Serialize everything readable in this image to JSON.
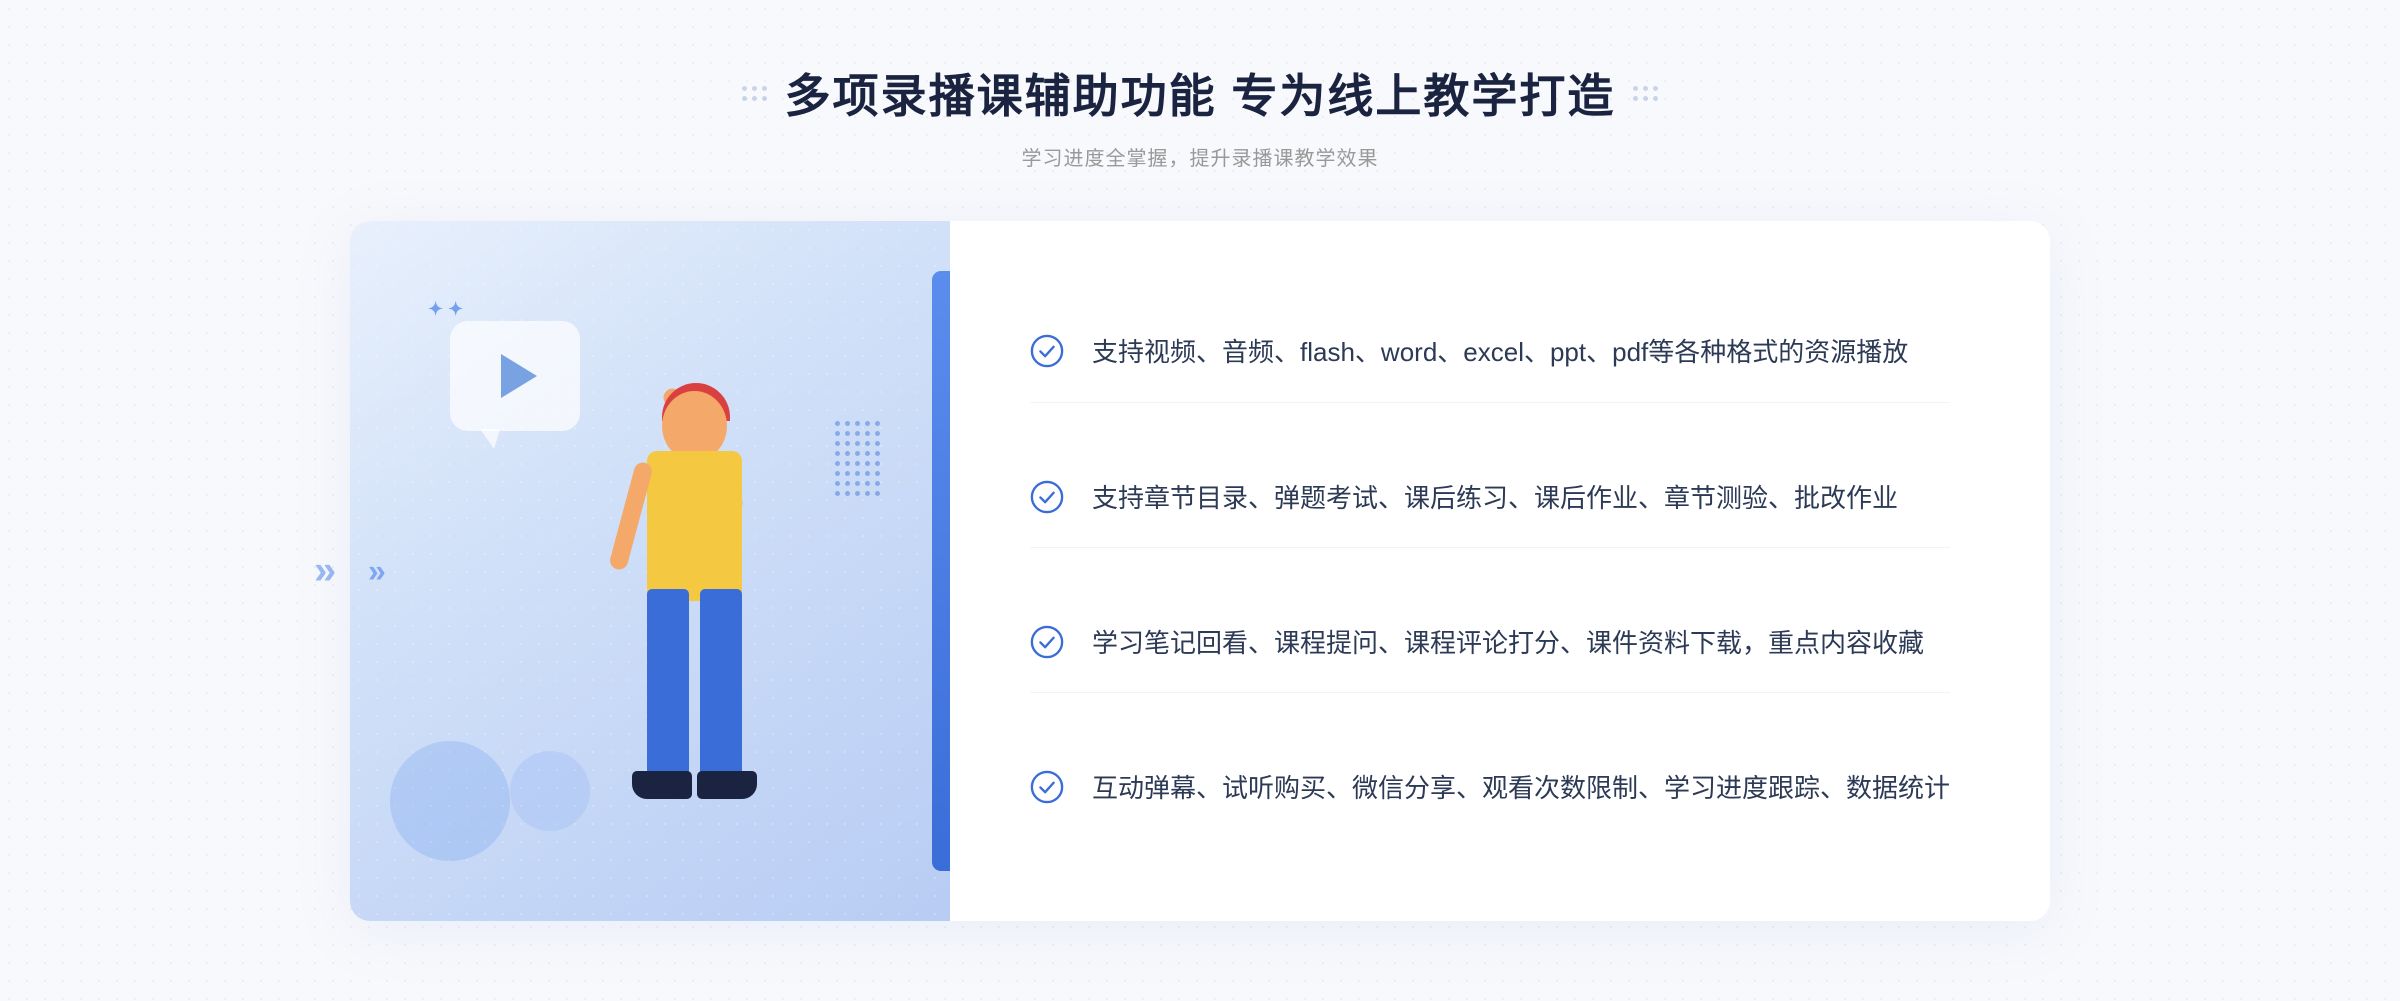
{
  "header": {
    "title": "多项录播课辅助功能 专为线上教学打造",
    "subtitle": "学习进度全掌握，提升录播课教学效果"
  },
  "features": [
    {
      "id": "feature-1",
      "text": "支持视频、音频、flash、word、excel、ppt、pdf等各种格式的资源播放"
    },
    {
      "id": "feature-2",
      "text": "支持章节目录、弹题考试、课后练习、课后作业、章节测验、批改作业"
    },
    {
      "id": "feature-3",
      "text": "学习笔记回看、课程提问、课程评论打分、课件资料下载，重点内容收藏"
    },
    {
      "id": "feature-4",
      "text": "互动弹幕、试听购买、微信分享、观看次数限制、学习进度跟踪、数据统计"
    }
  ],
  "icons": {
    "check": "check-circle-icon",
    "play": "play-icon",
    "chevron": "chevron-icon"
  },
  "colors": {
    "primary": "#3a6dd8",
    "text_dark": "#2d3a55",
    "text_light": "#999999",
    "accent": "#5b8dee",
    "bg_light": "#f8f9fc"
  }
}
